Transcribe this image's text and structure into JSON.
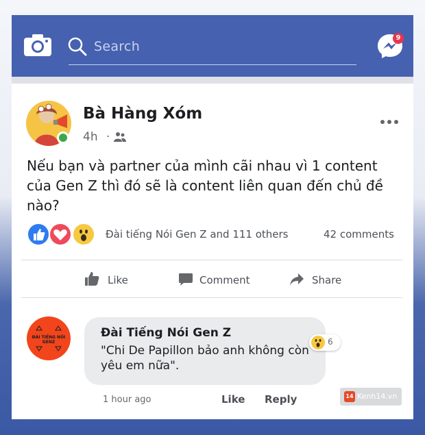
{
  "header": {
    "search_placeholder": "Search",
    "messenger_badge": "9",
    "icons": [
      "camera-icon",
      "search-icon",
      "messenger-icon"
    ]
  },
  "post": {
    "author": "Bà Hàng Xóm",
    "time": "4h",
    "separator": "·",
    "audience_icon": "friends-icon",
    "text": "Nếu bạn và partner của mình cãi nhau vì 1 content của Gen Z thì đó sẽ là content liên quan đến chủ đề nào?",
    "reactions": [
      "like",
      "love",
      "wow"
    ],
    "reactors": "Đài tiếng Nói Gen Z and 111 others",
    "comments_count": "42 comments"
  },
  "actions": {
    "like": "Like",
    "comment": "Comment",
    "share": "Share"
  },
  "comment": {
    "avatar_text": "ĐÀI TIẾNG NÓI GENZ",
    "name": "Đài Tiếng Nói Gen Z",
    "text": "\"Chi De Papillon bảo anh không còn yêu em nữa\".",
    "reaction_count": "6",
    "time": "1 hour ago",
    "like": "Like",
    "reply": "Reply"
  },
  "watermark": {
    "logo": "14",
    "text": "Kenh14.vn"
  },
  "colors": {
    "header_blue": "#4661b0",
    "like_blue": "#2f7bf0",
    "love_red": "#ee4a5c",
    "wow_yellow": "#f7c940",
    "badge_red": "#e9344a"
  }
}
